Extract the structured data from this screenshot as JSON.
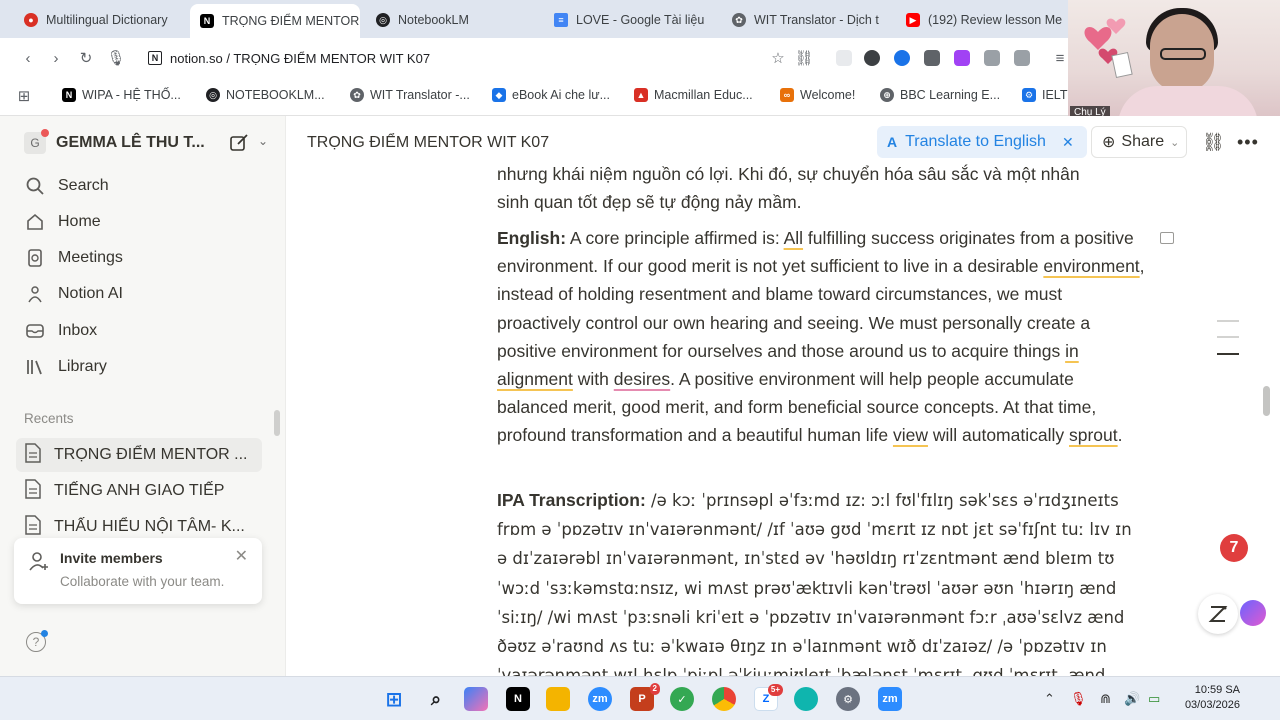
{
  "browser": {
    "tabs": [
      {
        "title": "Multilingual Dictionary",
        "color": "#d93025",
        "glyph": "●"
      },
      {
        "title": "TRỌNG ĐIỂM MENTOR",
        "color": "#000000",
        "glyph": "N",
        "active": true
      },
      {
        "title": "NotebookLM",
        "color": "#202124",
        "glyph": "◎"
      },
      {
        "title": "LOVE - Google Tài liệu",
        "color": "#4285f4",
        "glyph": "≡"
      },
      {
        "title": "WIT Translator - Dịch t",
        "color": "#5f6368",
        "glyph": "✿"
      },
      {
        "title": "(192) Review lesson Me",
        "color": "#ff0000",
        "glyph": "▶"
      }
    ],
    "url": "notion.so / TRỌNG ĐIỂM MENTOR WIT K07",
    "bookmarks": [
      {
        "label": "WIPA - HỆ THỐ...",
        "color": "#000000",
        "glyph": "N"
      },
      {
        "label": "NOTEBOOKLM...",
        "color": "#202124",
        "glyph": "◎"
      },
      {
        "label": "WIT Translator -...",
        "color": "#5f6368",
        "glyph": "✿"
      },
      {
        "label": "eBook Ai che lư...",
        "color": "#1a73e8",
        "glyph": "◆"
      },
      {
        "label": "Macmillan Educ...",
        "color": "#d93025",
        "glyph": "▲"
      },
      {
        "label": "Welcome!",
        "color": "#e8710a",
        "glyph": "∞"
      },
      {
        "label": "BBC Learning E...",
        "color": "#5f6368",
        "glyph": "⊕"
      },
      {
        "label": "IELT",
        "color": "#1a73e8",
        "glyph": "⚙"
      }
    ]
  },
  "webcam": {
    "name_tag": "Chụ Lý"
  },
  "sidebar": {
    "workspace_initial": "G",
    "workspace_name": "GEMMA LÊ THU T...",
    "nav": [
      {
        "label": "Search",
        "icon": "search-icon"
      },
      {
        "label": "Home",
        "icon": "home-icon"
      },
      {
        "label": "Meetings",
        "icon": "meetings-icon"
      },
      {
        "label": "Notion AI",
        "icon": "notion-ai-icon"
      },
      {
        "label": "Inbox",
        "icon": "inbox-icon"
      },
      {
        "label": "Library",
        "icon": "library-icon"
      }
    ],
    "recents_heading": "Recents",
    "recents": [
      {
        "label": "TRỌNG ĐIỂM MENTOR ...",
        "active": true
      },
      {
        "label": "TIẾNG ANH GIAO TIẾP"
      },
      {
        "label": "THẤU HIỂU NỘI TÂM- K..."
      }
    ],
    "popup": {
      "title": "Invite members",
      "subtitle": "Collaborate with your team."
    }
  },
  "topbar": {
    "breadcrumb": "TRỌNG ĐIỂM MENTOR WIT K07",
    "translate_label": "Translate to English",
    "share_label": "Share"
  },
  "content": {
    "vi_tail_line1": "nhưng khái niệm nguồn có lợi. Khi đó, sự chuyển hóa sâu sắc và một nhân",
    "vi_tail_line2": "sinh quan tốt đẹp sẽ tự động nảy mầm.",
    "english_label": "English:",
    "english_text": [
      " A core principle affirmed is: ",
      "All",
      " fulfilling success originates from a positive environment. If our good merit is not yet sufficient to live in a desirable ",
      "environment",
      ", instead of holding resentment and blame toward circumstances, we must proactively control our own hearing and seeing. We must personally create a positive environment for ourselves and those around us to acquire things ",
      "in alignment",
      " with ",
      "desires",
      ". A positive environment will help people accumulate balanced merit, good merit, and form beneficial source concepts. At that time, profound transformation and a beautiful human life ",
      "view",
      " will automatically ",
      "sprout",
      "."
    ],
    "ipa_label": "IPA Transcription:",
    "ipa_text": " /ə kɔː ˈprɪnsəpl əˈfɜːmd ɪz: ɔːl fʊlˈfɪlɪŋ səkˈsɛs əˈrɪdʒɪneɪts frɒm ə ˈpɒzətɪv ɪnˈvaɪərənmənt/ /ɪf ˈaʊə gʊd ˈmɛrɪt ɪz nɒt jɛt səˈfɪʃnt tuː lɪv ɪn ə dɪˈzaɪərəbl ɪnˈvaɪərənmənt, ɪnˈstɛd əv ˈhəʊldɪŋ rɪˈzɛntmənt ænd bleɪm tʊ ˈwɔːd ˈsɜːkəmstɑːnsɪz, wi mʌst prəʊˈæktɪvli kənˈtrəʊl ˈaʊər əʊn ˈhɪərɪŋ ænd ˈsiːɪŋ/ /wi mʌst ˈpɜːsnəli kriˈeɪt ə ˈpɒzətɪv ɪnˈvaɪərənmənt fɔːr ˌaʊəˈsɛlvz ænd ðəʊz əˈraʊnd ʌs tuː əˈkwaɪə θɪŋz ɪn əˈlaɪnmənt wɪð dɪˈzaɪəz/ /ə ˈpɒzətɪv ɪn ˈvaɪərənmənt wɪl hɛlp ˈpiːpl əˈkjuːmjʊleɪt ˈbælənst ˈmɛrɪt, gʊd ˈmɛrɪt, ænd"
  },
  "floating": {
    "notification_count": "7"
  },
  "taskbar": {
    "clock_time": "10:59 SA",
    "clock_date": "03/03/2026",
    "badges": {
      "powerpoint": "2",
      "zalo": "5+"
    }
  }
}
